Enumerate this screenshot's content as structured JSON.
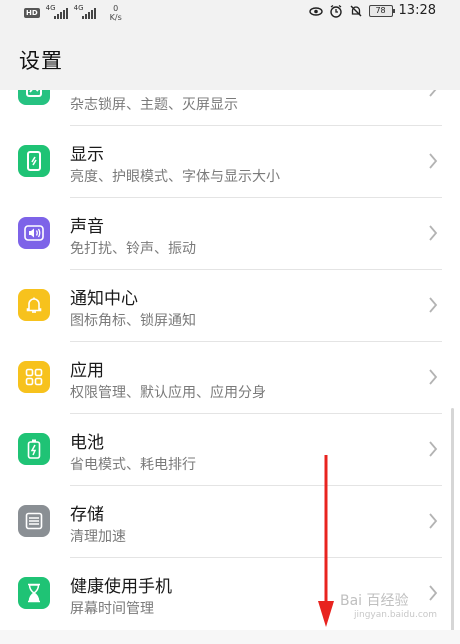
{
  "status_bar": {
    "hd": "HD",
    "signal1_label": "4G",
    "signal2_label": "4G",
    "net_speed": "0",
    "net_unit": "K/s",
    "battery": "78",
    "time": "13:28",
    "icons": [
      "eye-icon",
      "alarm-icon",
      "mute-icon"
    ]
  },
  "header": {
    "title": "设置"
  },
  "list": {
    "items": [
      {
        "title": "",
        "subtitle": "杂志锁屏、主题、灭屏显示",
        "icon": "wallpaper-icon",
        "color": "#26c281"
      },
      {
        "title": "显示",
        "subtitle": "亮度、护眼模式、字体与显示大小",
        "icon": "display-icon",
        "color": "#1fc375"
      },
      {
        "title": "声音",
        "subtitle": "免打扰、铃声、振动",
        "icon": "sound-icon",
        "color": "#7d63e8"
      },
      {
        "title": "通知中心",
        "subtitle": "图标角标、锁屏通知",
        "icon": "bell-icon",
        "color": "#f7c21d"
      },
      {
        "title": "应用",
        "subtitle": "权限管理、默认应用、应用分身",
        "icon": "apps-icon",
        "color": "#f7c21d"
      },
      {
        "title": "电池",
        "subtitle": "省电模式、耗电排行",
        "icon": "battery-icon",
        "color": "#1fc375"
      },
      {
        "title": "存储",
        "subtitle": "清理加速",
        "icon": "storage-icon",
        "color": "#8a8f94"
      },
      {
        "title": "健康使用手机",
        "subtitle": "屏幕时间管理",
        "icon": "hourglass-icon",
        "color": "#1fc375"
      }
    ]
  },
  "watermark": {
    "text": "Bai 百经验",
    "sub": "jingyan.baidu.com"
  },
  "colors": {
    "arrow": "#e8231f",
    "background": "#f2f2f2"
  }
}
